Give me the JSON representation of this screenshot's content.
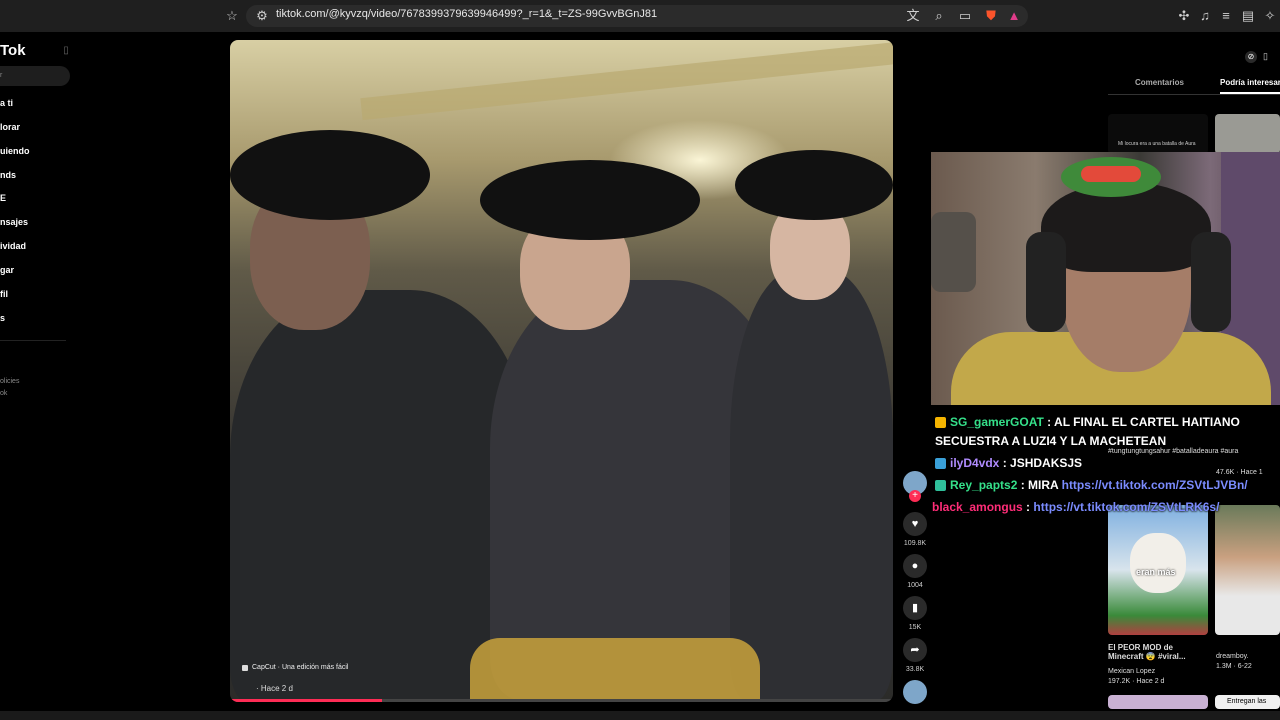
{
  "browser": {
    "url": "tiktok.com/@kyvzq/video/7678399379639946499?_r=1&_t=ZS-99GvvBGnJ81",
    "icons": [
      "bookmark-icon",
      "site-settings-icon",
      "translate-icon",
      "zoom-icon",
      "cast-icon",
      "brave-shield-icon",
      "brave-rewards-icon",
      "extensions-icon",
      "media-icon",
      "playlist-icon",
      "sidebar-icon",
      "wallet-icon",
      "bookmarks-icon"
    ]
  },
  "sidebar": {
    "logo": "Tok",
    "items": [
      "a ti",
      "lorar",
      "uiendo",
      "nds",
      "E",
      "nsajes",
      "ividad",
      "gar",
      "fil",
      "s"
    ],
    "footer": [
      "olicies",
      "ok"
    ]
  },
  "video": {
    "capcut": "CapCut · Una edición más fácil",
    "time": "· Hace 2 d",
    "progress": 0.23
  },
  "actions": {
    "likes": "109.8K",
    "comments": "1004",
    "saves": "15K",
    "shares": "33.8K"
  },
  "right_panel": {
    "tab_comments": "Comentarios",
    "tab_related": "Podría interesar",
    "top_caption": "Mi locura era a una batalla de Aura",
    "tags": "#tungtungtungsahur #batalladeaura #aura",
    "views_1": "47.6K · Hace 1",
    "thumb_text": "eran más",
    "item_title": "El PEOR MOD de Minecraft 😨 #viral...",
    "item_author": "Mexican Lopez",
    "item_stats": "197.2K · Hace 2 d",
    "item2_author": "dreamboy.",
    "item2_stats": "1.3M · 6-22",
    "bottom_label": "Entregan las"
  },
  "chat": [
    {
      "user": "SG_gamerGOAT",
      "color": "#35e08a",
      "message": ": AL FINAL EL CARTEL HAITIANO",
      "message2": "SECUESTRA A LUZI4 Y LA MACHETEAN"
    },
    {
      "user": "ilyD4vdx",
      "color": "#b08cff",
      "message": ": JSHDAKSJS"
    },
    {
      "user": "Rey_papts2",
      "color": "#35e08a",
      "message": ": MIRA",
      "link": "https://vt.tiktok.com/ZSVtLJVBn/"
    },
    {
      "user": "black_amongus",
      "color": "#ff2d78",
      "message": ":",
      "link": "https://vt.tiktok.com/ZSVtLRK6s/"
    }
  ]
}
